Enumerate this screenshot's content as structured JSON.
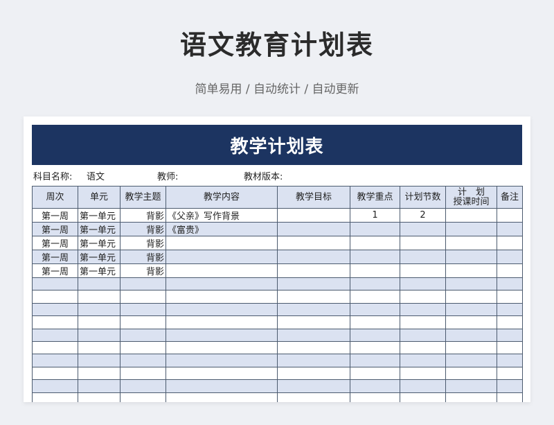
{
  "page": {
    "title": "语文教育计划表",
    "subtitle": "简单易用 / 自动统计 / 自动更新"
  },
  "sheet": {
    "banner": "教学计划表",
    "meta": {
      "subject_label": "科目名称:",
      "subject_value": "语文",
      "teacher_label": "教师:",
      "textbook_label": "教材版本:"
    },
    "columns": [
      "周次",
      "单元",
      "教学主题",
      "教学内容",
      "教学目标",
      "教学重点",
      "计划节数",
      "计　划\n授课时间",
      "备注"
    ],
    "rows": [
      [
        "第一周",
        "第一单元",
        "背影",
        "《父亲》写作背景",
        "",
        "1",
        "2",
        "",
        ""
      ],
      [
        "第一周",
        "第一单元",
        "背影",
        "《富贵》",
        "",
        "",
        "",
        "",
        ""
      ],
      [
        "第一周",
        "第一单元",
        "背影",
        "",
        "",
        "",
        "",
        "",
        ""
      ],
      [
        "第一周",
        "第一单元",
        "背影",
        "",
        "",
        "",
        "",
        "",
        ""
      ],
      [
        "第一周",
        "第一单元",
        "背影",
        "",
        "",
        "",
        "",
        "",
        ""
      ],
      [
        "",
        "",
        "",
        "",
        "",
        "",
        "",
        "",
        ""
      ],
      [
        "",
        "",
        "",
        "",
        "",
        "",
        "",
        "",
        ""
      ],
      [
        "",
        "",
        "",
        "",
        "",
        "",
        "",
        "",
        ""
      ],
      [
        "",
        "",
        "",
        "",
        "",
        "",
        "",
        "",
        ""
      ],
      [
        "",
        "",
        "",
        "",
        "",
        "",
        "",
        "",
        ""
      ],
      [
        "",
        "",
        "",
        "",
        "",
        "",
        "",
        "",
        ""
      ],
      [
        "",
        "",
        "",
        "",
        "",
        "",
        "",
        "",
        ""
      ],
      [
        "",
        "",
        "",
        "",
        "",
        "",
        "",
        "",
        ""
      ],
      [
        "",
        "",
        "",
        "",
        "",
        "",
        "",
        "",
        ""
      ],
      [
        "",
        "",
        "",
        "",
        "",
        "",
        "",
        "",
        ""
      ]
    ]
  },
  "colors": {
    "banner": "#1c3461",
    "stripe": "#dbe2f1",
    "background": "#eef0f4"
  }
}
